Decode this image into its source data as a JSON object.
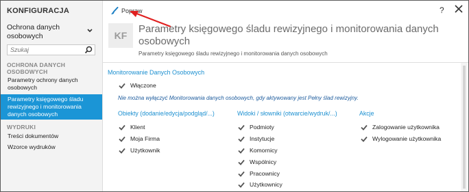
{
  "sidebar": {
    "title": "KONFIGURACJA",
    "module_select": "Ochrona danych osobowych",
    "search_placeholder": "Szukaj",
    "group1": "OCHRONA DANYCH OSOBOWYCH",
    "items1": [
      "Parametry ochrony danych osobowych",
      "Parametry księgowego śladu rewizyjnego i monitorowania danych osobowych"
    ],
    "group2": "WYDRUKI",
    "items2": [
      "Treści dokumentów",
      "Wzorce wydruków"
    ]
  },
  "toolbar": {
    "edit_label": "Popraw",
    "help_label": "?"
  },
  "header": {
    "badge": "KF",
    "title": "Parametry księgowego śladu rewizyjnego i monitorowania danych osobowych",
    "subtitle": "Parametry księgowego śladu rewizyjnego i monitorowania danych osobowych"
  },
  "content": {
    "section_title": "Monitorowanie Danych Osobowych",
    "enabled_label": "Włączone",
    "note": "Nie można wyłączyć Monitorowania danych osobowych, gdy aktywowany jest Pełny ślad rewizyjny.",
    "col1": {
      "title": "Obiekty (dodanie/edycja/podgląd/...)",
      "items": [
        "Klient",
        "Moja Firma",
        "Użytkownik"
      ]
    },
    "col2": {
      "title": "Widoki / słowniki (otwarcie/wydruk/...)",
      "items": [
        "Podmioty",
        "Instytucje",
        "Komornicy",
        "Wspólnicy",
        "Pracownicy",
        "Użytkownicy"
      ]
    },
    "col3": {
      "title": "Akcje",
      "items": [
        "Zalogowanie użytkownika",
        "Wylogowanie użytkownika"
      ]
    }
  },
  "colors": {
    "accent": "#1b95d6",
    "note": "#1b5a9c",
    "annotation_arrow": "#e02020"
  }
}
